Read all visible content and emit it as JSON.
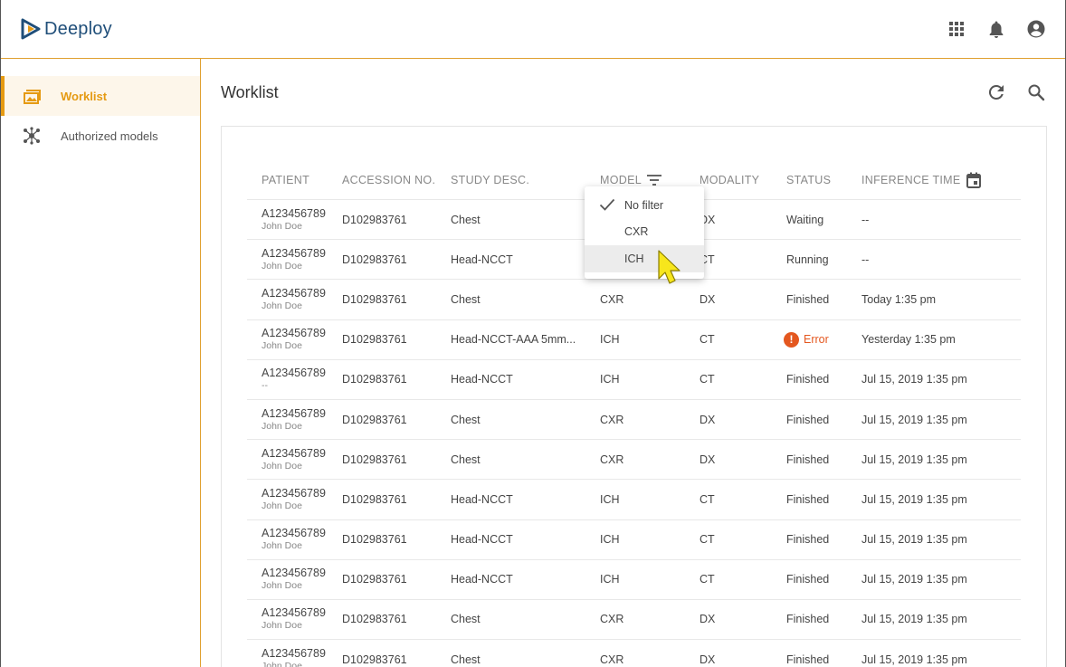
{
  "app": {
    "name": "Deeploy"
  },
  "topbar": {
    "icons": [
      "apps-grid-icon",
      "bell-icon",
      "account-icon"
    ]
  },
  "sidebar": {
    "items": [
      {
        "label": "Worklist",
        "icon": "worklist-icon",
        "active": true
      },
      {
        "label": "Authorized models",
        "icon": "models-icon",
        "active": false
      }
    ]
  },
  "main": {
    "title": "Worklist",
    "actions": [
      "refresh-icon",
      "search-icon"
    ]
  },
  "table": {
    "headers": {
      "patient": "PATIENT",
      "accession": "ACCESSION NO.",
      "study": "STUDY DESC.",
      "model": "MODEL",
      "modality": "MODALITY",
      "status": "STATUS",
      "inference": "INFERENCE TIME"
    },
    "rows": [
      {
        "patient_id": "A123456789",
        "patient_name": "John Doe",
        "accession": "D102983761",
        "study": "Chest",
        "model": "",
        "modality": "DX",
        "status": "Waiting",
        "inference_time": "--"
      },
      {
        "patient_id": "A123456789",
        "patient_name": "John Doe",
        "accession": "D102983761",
        "study": "Head-NCCT",
        "model": "",
        "modality": "CT",
        "status": "Running",
        "inference_time": "--"
      },
      {
        "patient_id": "A123456789",
        "patient_name": "John Doe",
        "accession": "D102983761",
        "study": "Chest",
        "model": "CXR",
        "modality": "DX",
        "status": "Finished",
        "inference_time": "Today 1:35 pm"
      },
      {
        "patient_id": "A123456789",
        "patient_name": "John Doe",
        "accession": "D102983761",
        "study": "Head-NCCT-AAA 5mm...",
        "model": "ICH",
        "modality": "CT",
        "status": "Error",
        "inference_time": "Yesterday 1:35 pm"
      },
      {
        "patient_id": "A123456789",
        "patient_name": "--",
        "accession": "D102983761",
        "study": "Head-NCCT",
        "model": "ICH",
        "modality": "CT",
        "status": "Finished",
        "inference_time": "Jul 15, 2019 1:35 pm"
      },
      {
        "patient_id": "A123456789",
        "patient_name": "John Doe",
        "accession": "D102983761",
        "study": "Chest",
        "model": "CXR",
        "modality": "DX",
        "status": "Finished",
        "inference_time": "Jul 15, 2019 1:35 pm"
      },
      {
        "patient_id": "A123456789",
        "patient_name": "John Doe",
        "accession": "D102983761",
        "study": "Chest",
        "model": "CXR",
        "modality": "DX",
        "status": "Finished",
        "inference_time": "Jul 15, 2019 1:35 pm"
      },
      {
        "patient_id": "A123456789",
        "patient_name": "John Doe",
        "accession": "D102983761",
        "study": "Head-NCCT",
        "model": "ICH",
        "modality": "CT",
        "status": "Finished",
        "inference_time": "Jul 15, 2019 1:35 pm"
      },
      {
        "patient_id": "A123456789",
        "patient_name": "John Doe",
        "accession": "D102983761",
        "study": "Head-NCCT",
        "model": "ICH",
        "modality": "CT",
        "status": "Finished",
        "inference_time": "Jul 15, 2019 1:35 pm"
      },
      {
        "patient_id": "A123456789",
        "patient_name": "John Doe",
        "accession": "D102983761",
        "study": "Head-NCCT",
        "model": "ICH",
        "modality": "CT",
        "status": "Finished",
        "inference_time": "Jul 15, 2019 1:35 pm"
      },
      {
        "patient_id": "A123456789",
        "patient_name": "John Doe",
        "accession": "D102983761",
        "study": "Chest",
        "model": "CXR",
        "modality": "DX",
        "status": "Finished",
        "inference_time": "Jul 15, 2019 1:35 pm"
      },
      {
        "patient_id": "A123456789",
        "patient_name": "John Doe",
        "accession": "D102983761",
        "study": "Chest",
        "model": "CXR",
        "modality": "DX",
        "status": "Finished",
        "inference_time": "Jul 15, 2019 1:35 pm"
      }
    ]
  },
  "model_filter": {
    "options": [
      {
        "label": "No filter",
        "checked": true
      },
      {
        "label": "CXR",
        "checked": false
      },
      {
        "label": "ICH",
        "checked": false,
        "hovered": true
      }
    ]
  },
  "colors": {
    "accent": "#e59a12",
    "brand_blue": "#1f4e79",
    "error": "#e4571f"
  }
}
